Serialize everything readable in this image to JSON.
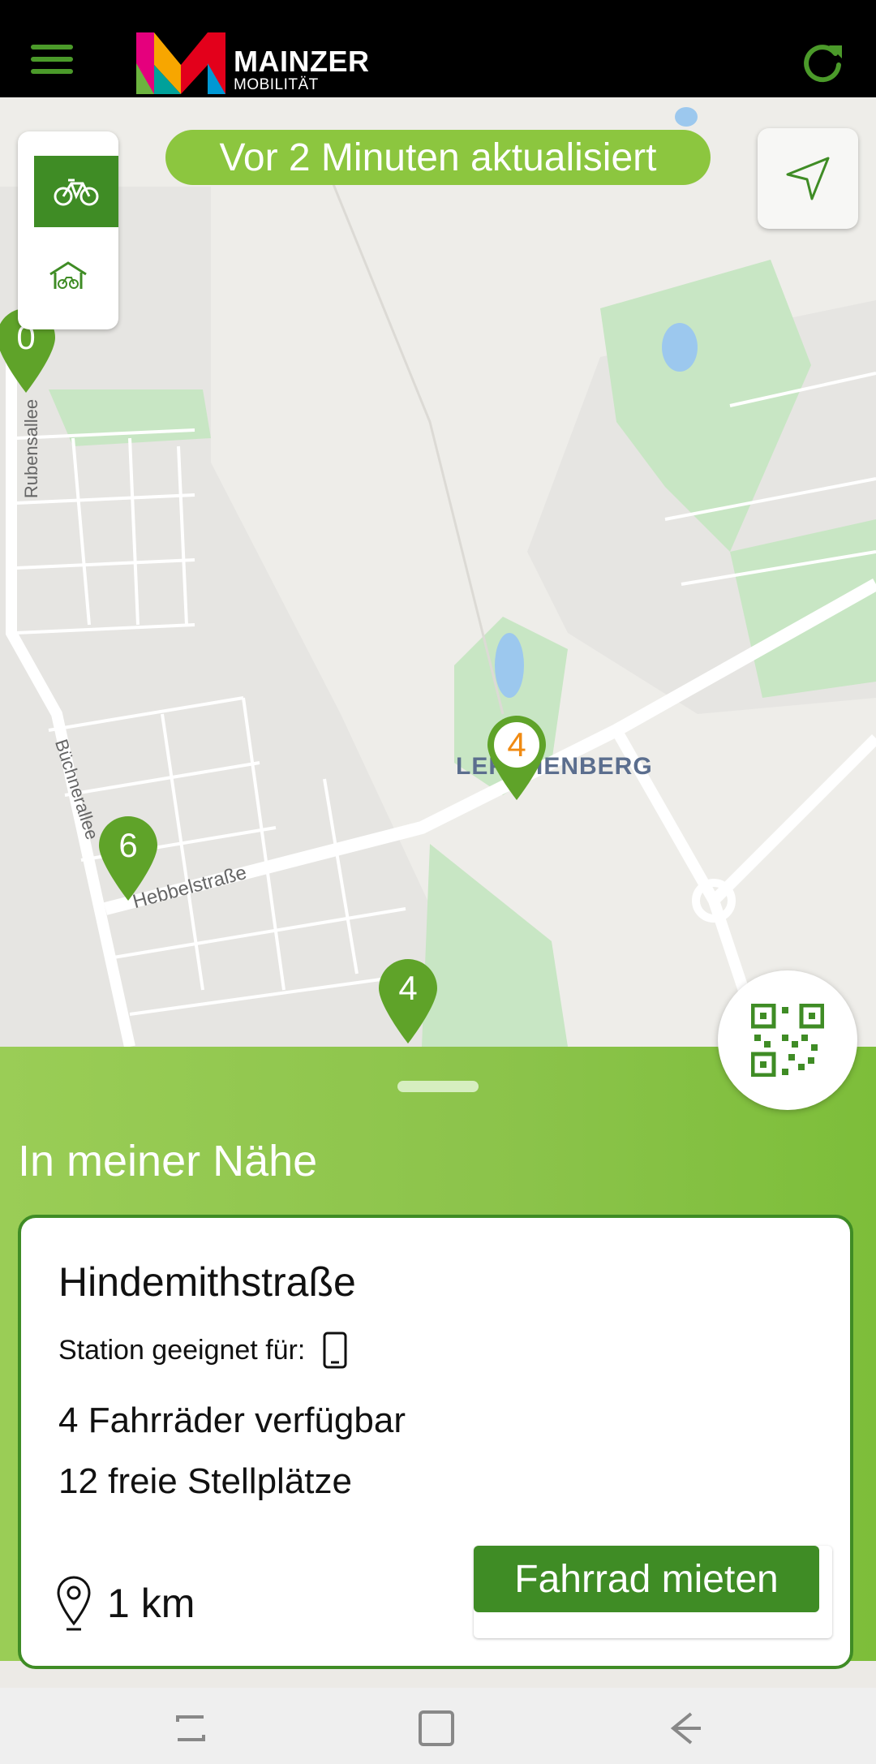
{
  "header": {
    "brand_name": "MAINZER",
    "brand_sub": "MOBILITÄT",
    "menu_icon": "hamburger-menu-icon",
    "refresh_icon": "refresh-icon",
    "accent_color": "#4b9a2a"
  },
  "map": {
    "update_status": "Vor 2 Minuten aktualisiert",
    "place_label": "LERCHENBERG",
    "street_labels": {
      "rubensallee": "Rubensallee",
      "buechnerallee": "Büchnerallee",
      "hebbelstrasse": "Hebbelstraße"
    },
    "pins": [
      {
        "value": "0",
        "highlighted": false
      },
      {
        "value": "4",
        "highlighted": true
      },
      {
        "value": "6",
        "highlighted": false
      },
      {
        "value": "4",
        "highlighted": false
      }
    ],
    "layer_toggle": {
      "bike_icon": "bicycle-icon",
      "garage_icon": "bike-garage-icon"
    },
    "locate_icon": "navigation-arrow-icon",
    "qr_icon": "qr-code-icon"
  },
  "nearby": {
    "title": "In meiner Nähe",
    "station": {
      "name": "Hindemithstraße",
      "suited_label": "Station geeignet für:",
      "bikes_available": "4 Fahrräder verfügbar",
      "free_slots": "12 freie Stellplätze",
      "distance": "1 km",
      "rent_label": "Fahrrad mieten"
    }
  },
  "colors": {
    "primary_green": "#3f8c25",
    "light_green": "#8cc63f",
    "pin_highlight": "#f08a12"
  }
}
